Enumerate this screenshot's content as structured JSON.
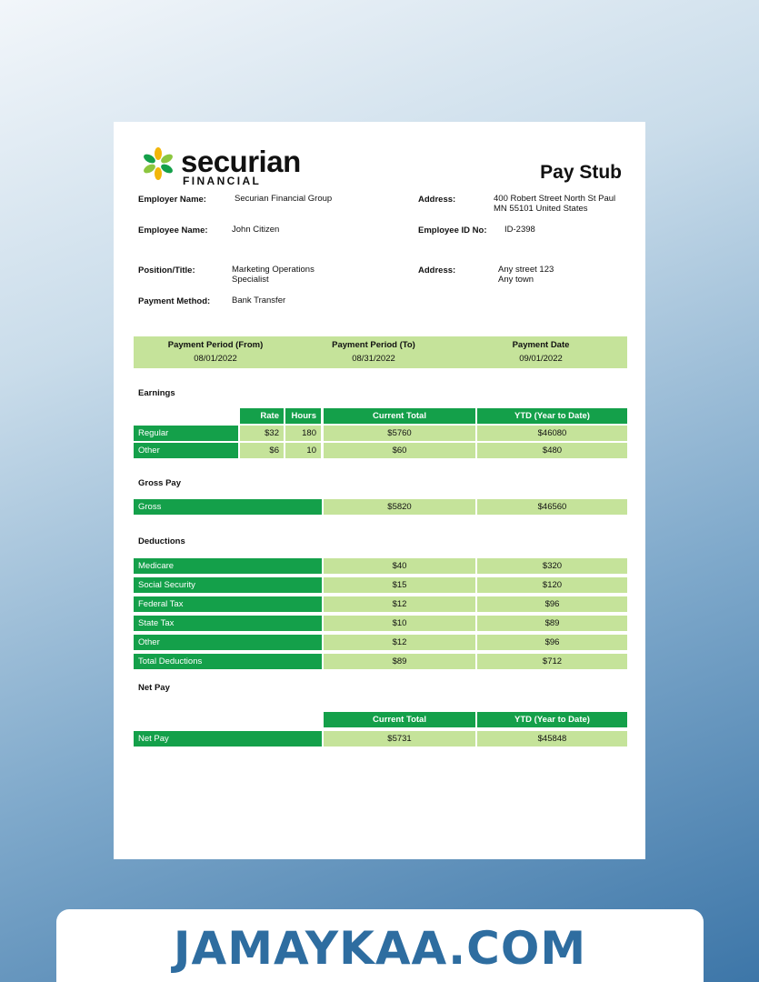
{
  "logo": {
    "name": "securian",
    "sub": "FINANCIAL"
  },
  "title": "Pay Stub",
  "info": {
    "employer_label": "Employer Name:",
    "employer_value": "Securian Financial Group",
    "address1_label": "Address:",
    "address1_line1": "400 Robert Street North St Paul",
    "address1_line2": "MN 55101 United States",
    "employee_label": "Employee Name:",
    "employee_value": "John Citizen",
    "empid_label": "Employee ID No:",
    "empid_value": "ID-2398",
    "position_label": "Position/Title:",
    "position_line1": "Marketing Operations",
    "position_line2": "Specialist",
    "address2_label": "Address:",
    "address2_line1": "Any street 123",
    "address2_line2": "Any town",
    "payment_label": "Payment Method:",
    "payment_value": "Bank Transfer"
  },
  "period": {
    "from_label": "Payment Period (From)",
    "from_value": "08/01/2022",
    "to_label": "Payment Period (To)",
    "to_value": "08/31/2022",
    "date_label": "Payment Date",
    "date_value": "09/01/2022"
  },
  "earnings": {
    "title": "Earnings",
    "headers": {
      "rate": "Rate",
      "hours": "Hours",
      "current": "Current Total",
      "ytd": "YTD (Year to Date)"
    },
    "rows": [
      {
        "label": "Regular",
        "rate": "$32",
        "hours": "180",
        "current": "$5760",
        "ytd": "$46080"
      },
      {
        "label": "Other",
        "rate": "$6",
        "hours": "10",
        "current": "$60",
        "ytd": "$480"
      }
    ]
  },
  "gross": {
    "title": "Gross Pay",
    "label": "Gross",
    "current": "$5820",
    "ytd": "$46560"
  },
  "deductions": {
    "title": "Deductions",
    "rows": [
      {
        "label": "Medicare",
        "current": "$40",
        "ytd": "$320"
      },
      {
        "label": "Social Security",
        "current": "$15",
        "ytd": "$120"
      },
      {
        "label": "Federal Tax",
        "current": "$12",
        "ytd": "$96"
      },
      {
        "label": "State Tax",
        "current": "$10",
        "ytd": "$89"
      },
      {
        "label": "Other",
        "current": "$12",
        "ytd": "$96"
      },
      {
        "label": "Total Deductions",
        "current": "$89",
        "ytd": "$712"
      }
    ]
  },
  "net": {
    "title": "Net Pay",
    "headers": {
      "current": "Current Total",
      "ytd": "YTD (Year to Date)"
    },
    "label": "Net Pay",
    "current": "$5731",
    "ytd": "$45848"
  },
  "footer": {
    "text": "JAMAYKAA.COM"
  },
  "colors": {
    "dark_green": "#14a04a",
    "light_green": "#c5e39a",
    "footer_blue": "#2e6da0"
  }
}
